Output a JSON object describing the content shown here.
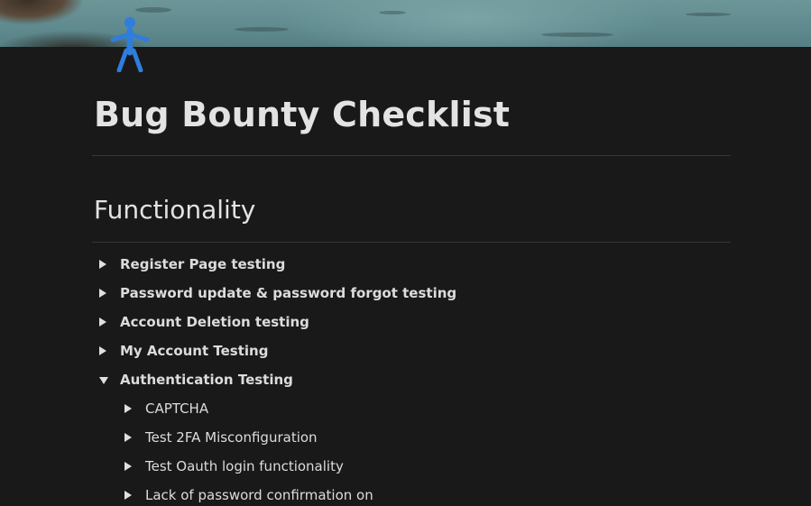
{
  "page": {
    "icon": "person-accessibility-icon",
    "title": "Bug Bounty Checklist"
  },
  "section": {
    "heading": "Functionality"
  },
  "toggles": [
    {
      "label": "Register Page testing",
      "expanded": false,
      "level": 1
    },
    {
      "label": "Password update & password forgot testing",
      "expanded": false,
      "level": 1
    },
    {
      "label": "Account Deletion testing",
      "expanded": false,
      "level": 1
    },
    {
      "label": "My Account Testing",
      "expanded": false,
      "level": 1
    },
    {
      "label": "Authentication Testing",
      "expanded": true,
      "level": 1
    },
    {
      "label": "CAPTCHA",
      "expanded": false,
      "level": 2
    },
    {
      "label": "Test 2FA Misconfiguration",
      "expanded": false,
      "level": 2
    },
    {
      "label": "Test Oauth login functionality",
      "expanded": false,
      "level": 2
    },
    {
      "label": "Lack of password confirmation on",
      "expanded": false,
      "level": 2
    }
  ],
  "colors": {
    "background": "#191919",
    "text": "#e3e3e3",
    "icon": "#2f7ddc",
    "divider": "#373737"
  }
}
